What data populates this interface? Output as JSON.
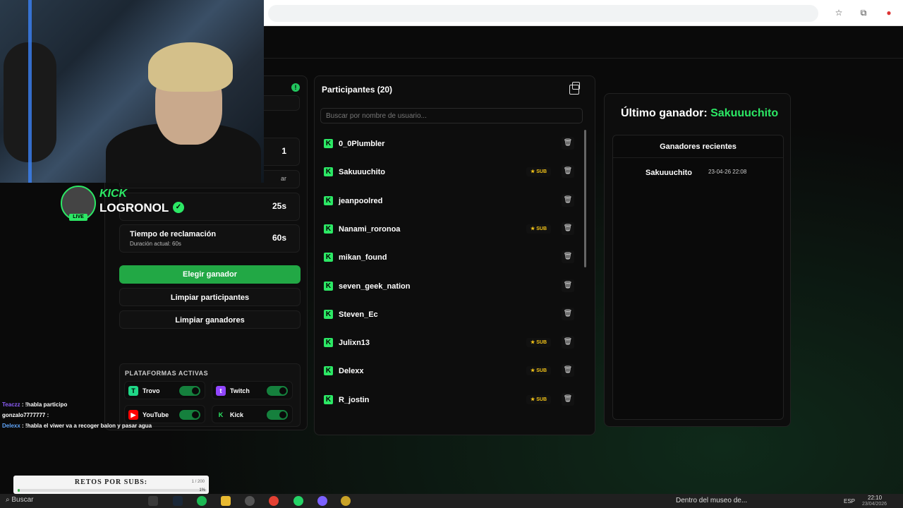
{
  "left_panel": {
    "settings": [
      {
        "label": "",
        "sublabel": "",
        "value": "1"
      },
      {
        "label": "",
        "sublabel": "",
        "value": ""
      },
      {
        "label": "",
        "sublabel": "",
        "value": "25s"
      },
      {
        "label": "Tiempo de reclamación",
        "sublabel": "Duración actual: 60s",
        "value": "60s"
      }
    ],
    "partial_text": "ar",
    "buttons": {
      "pick_winner": "Elegir ganador",
      "clear_participants": "Limpiar participantes",
      "clear_winners": "Limpiar ganadores"
    },
    "platforms_title": "PLATAFORMAS ACTIVAS",
    "platforms": [
      {
        "name": "Trovo",
        "enabled": true,
        "color": "#1fd887"
      },
      {
        "name": "Twitch",
        "enabled": true,
        "color": "#9146ff"
      },
      {
        "name": "YouTube",
        "enabled": true,
        "color": "#ff0000"
      },
      {
        "name": "Kick",
        "enabled": true,
        "color": "#2ce865"
      }
    ]
  },
  "participants": {
    "title": "Participantes (20)",
    "search_placeholder": "Buscar por nombre de usuario...",
    "items": [
      {
        "name": "0_0Plumbler",
        "sub": false
      },
      {
        "name": "Sakuuuchito",
        "sub": true
      },
      {
        "name": "jeanpoolred",
        "sub": false
      },
      {
        "name": "Nanami_roronoa",
        "sub": true
      },
      {
        "name": "mikan_found",
        "sub": false
      },
      {
        "name": "seven_geek_nation",
        "sub": false
      },
      {
        "name": "Steven_Ec",
        "sub": false
      },
      {
        "name": "Julixn13",
        "sub": true
      },
      {
        "name": "Delexx",
        "sub": true
      },
      {
        "name": "R_jostin",
        "sub": true
      }
    ],
    "sub_label": "SUB"
  },
  "winner": {
    "prefix": "Último ganador:",
    "name": "Sakuuuchito",
    "recent_title": "Ganadores recientes",
    "recent": [
      {
        "name": "Sakuuuchito",
        "date": "23-04-26 22:08"
      }
    ]
  },
  "overlay": {
    "brand": "KICK",
    "channel_name": "LOGRONOL",
    "live_label": "LIVE",
    "chat": [
      {
        "user": "Teaczz",
        "text": ": !habla participo"
      },
      {
        "user": "gonzalo7777777",
        "text": ":"
      },
      {
        "user": "Delexx",
        "text": ": !habla el viwer va a recoger balon y pasar agua"
      }
    ],
    "retos": {
      "title": "RETOS POR SUBS:",
      "count": "1 / 200",
      "percent": "1%",
      "progress": 0.01
    }
  },
  "taskbar": {
    "search": "Buscar",
    "media": "Dentro del museo de...",
    "lang": "ESP",
    "time": "22:10",
    "date": "23/04/2026"
  },
  "colors": {
    "accent": "#2ce865",
    "primary_button": "#22a845"
  }
}
